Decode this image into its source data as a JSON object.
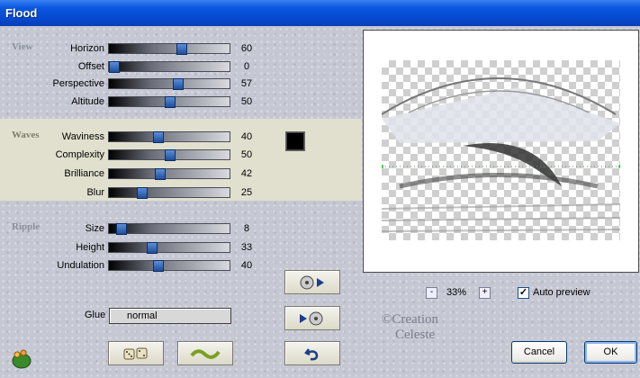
{
  "window": {
    "title": "Flood"
  },
  "groups": {
    "view": "View",
    "waves": "Waves",
    "ripple": "Ripple"
  },
  "sliders": [
    {
      "label": "Horizon",
      "value": "60"
    },
    {
      "label": "Offset",
      "value": "0"
    },
    {
      "label": "Perspective",
      "value": "57"
    },
    {
      "label": "Altitude",
      "value": "50"
    },
    {
      "label": "Waviness",
      "value": "40"
    },
    {
      "label": "Complexity",
      "value": "50"
    },
    {
      "label": "Brilliance",
      "value": "42"
    },
    {
      "label": "Blur",
      "value": "25"
    },
    {
      "label": "Size",
      "value": "8"
    },
    {
      "label": "Height",
      "value": "33"
    },
    {
      "label": "Undulation",
      "value": "40"
    }
  ],
  "color_swatch": "#000000",
  "glue": {
    "label": "Glue",
    "value": "normal"
  },
  "zoom": {
    "minus": "-",
    "value": "33%",
    "plus": "+"
  },
  "auto_preview": {
    "label": "Auto preview",
    "checked": true
  },
  "buttons": {
    "cancel": "Cancel",
    "ok": "OK"
  },
  "watermark": {
    "line1": "©Creation",
    "line2": "Celeste"
  }
}
